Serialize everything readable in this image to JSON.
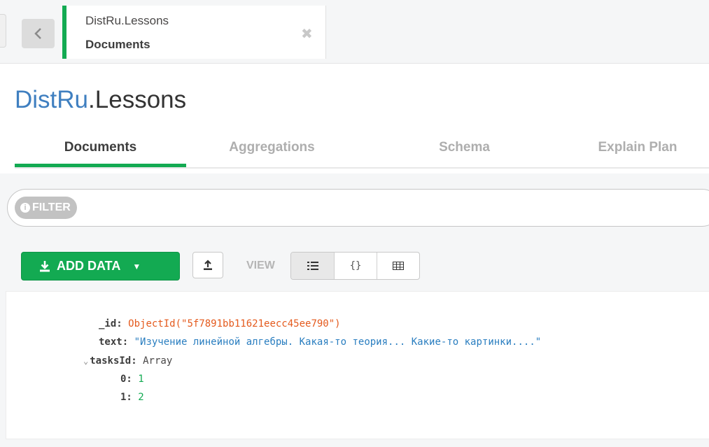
{
  "tab": {
    "namespace": "DistRu.Lessons",
    "subtitle": "Documents",
    "close_glyph": "✖"
  },
  "header": {
    "db": "DistRu",
    "dot": ".",
    "collection": "Lessons"
  },
  "nav_tabs": [
    "Documents",
    "Aggregations",
    "Schema",
    "Explain Plan"
  ],
  "active_tab": "Documents",
  "filter": {
    "label": "FILTER",
    "info_glyph": "i"
  },
  "toolbar": {
    "add_data_label": "ADD DATA",
    "caret": "▼",
    "view_label": "VIEW",
    "view_modes": [
      "list-icon",
      "json-icon",
      "table-icon"
    ],
    "json_glyph": "{}"
  },
  "document": {
    "id_key": "_id:",
    "id_value": "ObjectId(\"5f7891bb11621eecc45ee790\")",
    "text_key": "text:",
    "text_value": "\"Изучение линейной алгебры. Какая-то теория... Какие-то картинки....\"",
    "tasks_key": "tasksId:",
    "tasks_type": "Array",
    "expand_glyph": "⌄",
    "items": [
      {
        "key": "0:",
        "value": "1"
      },
      {
        "key": "1:",
        "value": "2"
      }
    ]
  },
  "colors": {
    "accent": "#13aa52",
    "db_name": "#3f7fc0",
    "object_id": "#e45a1d",
    "string": "#2a7ec0",
    "number": "#13aa52"
  }
}
